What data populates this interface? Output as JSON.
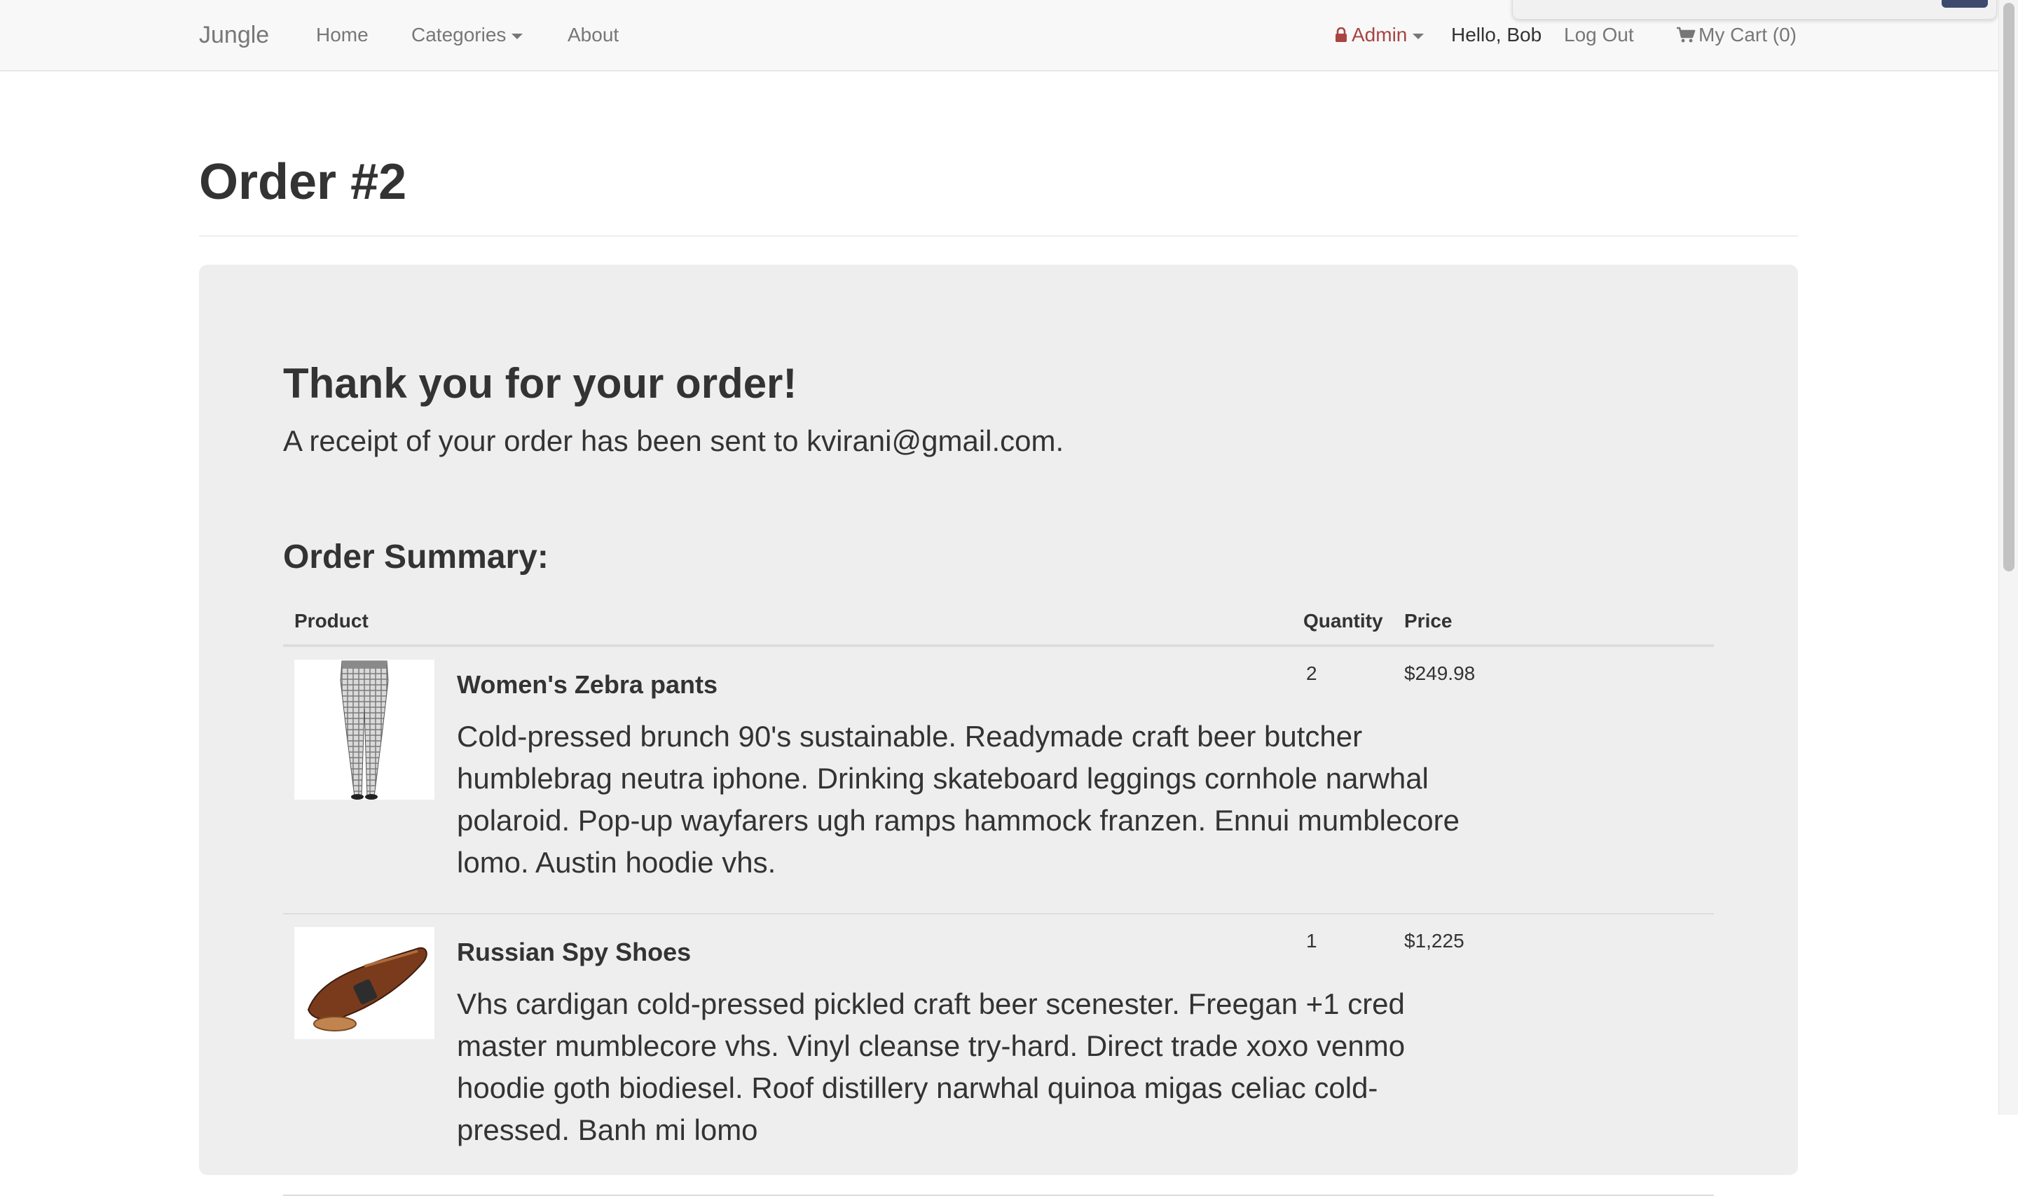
{
  "navbar": {
    "brand": "Jungle",
    "home": "Home",
    "categories": "Categories",
    "about": "About",
    "admin": "Admin",
    "greeting": "Hello, Bob",
    "logout": "Log Out",
    "cart": "My Cart (0)"
  },
  "page": {
    "title": "Order #2"
  },
  "confirmation": {
    "heading": "Thank you for your order!",
    "receipt": "A receipt of your order has been sent to kvirani@gmail.com.",
    "summary_title": "Order Summary:"
  },
  "table": {
    "headers": {
      "product": "Product",
      "quantity": "Quantity",
      "price": "Price"
    },
    "rows": [
      {
        "name": "Women's Zebra pants",
        "description": "Cold-pressed brunch 90's sustainable. Readymade craft beer butcher humblebrag neutra iphone. Drinking skateboard leggings cornhole narwhal polaroid. Pop-up wayfarers ugh ramps hammock franzen. Ennui mumblecore lomo. Austin hoodie vhs.",
        "quantity": "2",
        "price": "$249.98",
        "image_icon": "pants-image"
      },
      {
        "name": "Russian Spy Shoes",
        "description": "Vhs cardigan cold-pressed pickled craft beer scenester. Freegan +1 cred master mumblecore vhs. Vinyl cleanse try-hard. Direct trade xoxo venmo hoodie goth biodiesel. Roof distillery narwhal quinoa migas celiac cold-pressed. Banh mi lomo",
        "quantity": "1",
        "price": "$1,225",
        "image_icon": "shoe-image"
      }
    ]
  },
  "colors": {
    "navbar_bg": "#f8f8f8",
    "nav_link": "#777777",
    "admin_accent": "#a94442",
    "jumbotron_bg": "#eeeeee",
    "text": "#333333"
  }
}
